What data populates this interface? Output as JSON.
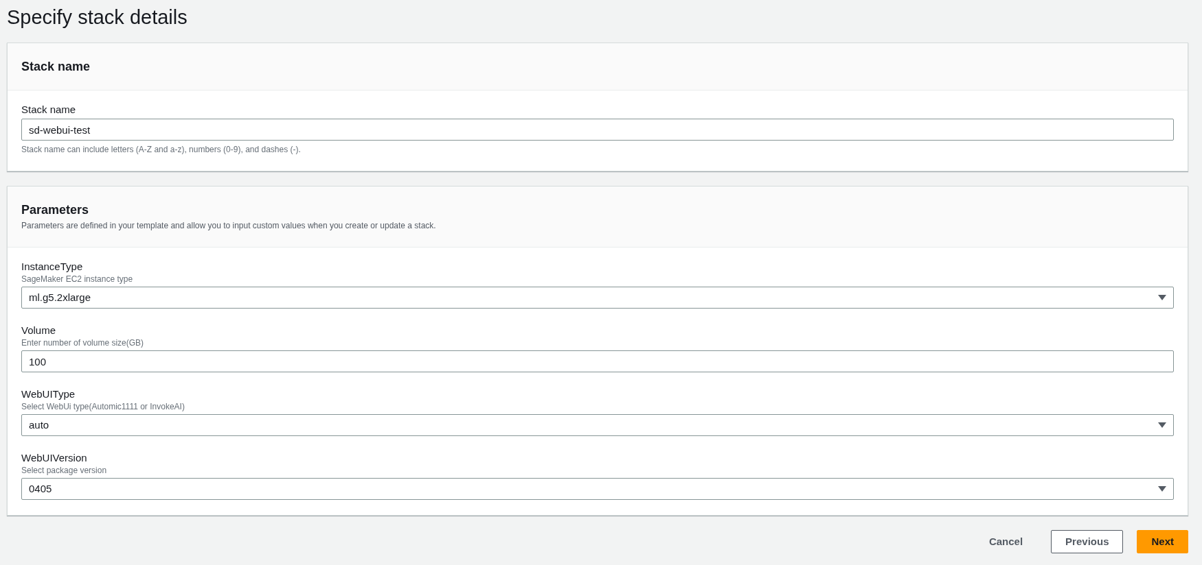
{
  "page_title": "Specify stack details",
  "sections": [
    {
      "title": "Stack name",
      "fields": [
        {
          "kind": "text",
          "label": "Stack name",
          "value": "sd-webui-test",
          "constraint": "Stack name can include letters (A-Z and a-z), numbers (0-9), and dashes (-)."
        }
      ]
    },
    {
      "title": "Parameters",
      "description": "Parameters are defined in your template and allow you to input custom values when you create or update a stack.",
      "fields": [
        {
          "kind": "select",
          "label": "InstanceType",
          "description": "SageMaker EC2 instance type",
          "value": "ml.g5.2xlarge"
        },
        {
          "kind": "text",
          "label": "Volume",
          "description": "Enter number of volume size(GB)",
          "value": "100"
        },
        {
          "kind": "select",
          "label": "WebUIType",
          "description": "Select WebUi type(Automic1111 or InvokeAI)",
          "value": "auto"
        },
        {
          "kind": "select",
          "label": "WebUIVersion",
          "description": "Select package version",
          "value": "0405"
        }
      ]
    }
  ],
  "actions": [
    {
      "kind": "link",
      "label": "Cancel"
    },
    {
      "kind": "normal",
      "label": "Previous"
    },
    {
      "kind": "primary",
      "label": "Next"
    }
  ]
}
